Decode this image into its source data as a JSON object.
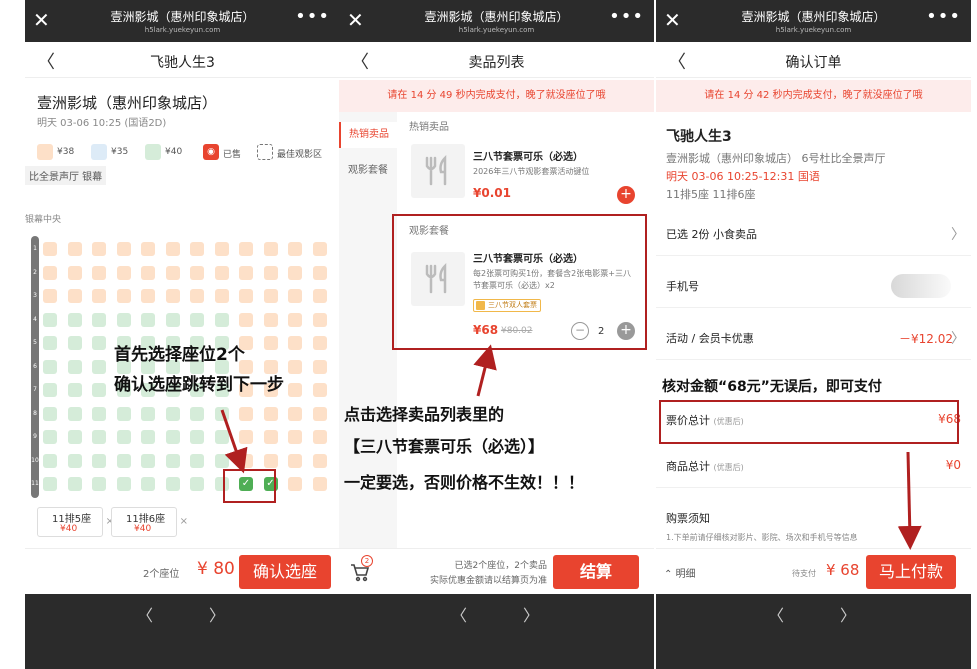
{
  "common": {
    "cinema_header": "壹洲影城（惠州印象城店）",
    "header_domain": "h5lark.yuekeyun.com"
  },
  "phone1": {
    "nav_title": "飞驰人生3",
    "cinema_name": "壹洲影城（惠州印象城店）",
    "show_time": "明天 03-06 10:25 (国语2D)",
    "legend": [
      {
        "label": "¥38",
        "color": "#fde0c8"
      },
      {
        "label": "¥35",
        "color": "#ddebf7"
      },
      {
        "label": "¥40",
        "color": "#d5ecd9"
      },
      {
        "label": "已售",
        "color": "#e8442f"
      },
      {
        "label": "最佳观影区",
        "color": "#ffffff"
      }
    ],
    "hall_label": "比全景声厅 银幕",
    "screen_label": "银幕中央",
    "row_numbers": [
      "1",
      "2",
      "3",
      "4",
      "5",
      "6",
      "7",
      "8",
      "9",
      "10",
      "11"
    ],
    "selected_seats": [
      {
        "name": "11排5座",
        "price": "¥40"
      },
      {
        "name": "11排6座",
        "price": "¥40"
      }
    ],
    "seat_count": "2个座位",
    "total": "¥ 80",
    "confirm_label": "确认选座",
    "annotation": [
      "首先选择座位2个",
      "确认选座跳转到下一步"
    ]
  },
  "phone2": {
    "nav_title": "卖品列表",
    "timer": "请在 14 分 49 秒内完成支付，晚了就没座位了哦",
    "categories": [
      "热销卖品",
      "观影套餐"
    ],
    "section1_title": "热销卖品",
    "item1": {
      "name": "三八节套票可乐（必选）",
      "desc": "2026年三八节观影套票活动键位",
      "price": "¥0.01"
    },
    "section2_title": "观影套餐",
    "item2": {
      "name": "三八节套票可乐（必选）",
      "desc1": "每2张票可购买1份，套餐含2张电影票+三八",
      "desc2": "节套票可乐（必选）x2",
      "tag": "三八节双人套票",
      "price": "¥68",
      "old_price": "¥80.02",
      "qty": "2"
    },
    "cart_badge": "2",
    "footer_info1": "已选2个座位，2个卖品",
    "footer_info2": "实际优惠金额请以结算页为准",
    "pay_label": "结算",
    "annotation": [
      "点击选择卖品列表里的",
      "【三八节套票可乐（必选）】",
      "一定要选，否则价格不生效！！！"
    ]
  },
  "phone3": {
    "nav_title": "确认订单",
    "timer": "请在 14 分 42 秒内完成支付，晚了就没座位了哦",
    "movie": "飞驰人生3",
    "cinema_line": "壹洲影城（惠州印象城店） 6号杜比全景声厅",
    "time_line": "明天 03-06 10:25-12:31 国语",
    "seats_line": "11排5座  11排6座",
    "snack_row": "已选 2份 小食卖品",
    "phone_label": "手机号",
    "promo_label": "活动 / 会员卡优惠",
    "promo_value": "－¥12.02",
    "annotation": "核对金额“68元”无误后，即可支付",
    "ticket_total_label": "票价总计",
    "after_discount": "(优惠后)",
    "ticket_total": "¥68",
    "goods_total_label": "商品总计",
    "goods_total": "¥0",
    "notice_title": "购票须知",
    "notice_desc": "1.下单前请仔细核对影片、影院、场次和手机号等信息",
    "detail_label": "明细",
    "due_label": "待支付",
    "due_price": "¥ 68",
    "pay_now": "马上付款"
  },
  "icons": [
    "close-icon",
    "more-icon",
    "back-icon",
    "chevron-right-icon",
    "cart-icon",
    "fork-knife-icon",
    "check-icon"
  ],
  "accent_color": "#e8442f"
}
